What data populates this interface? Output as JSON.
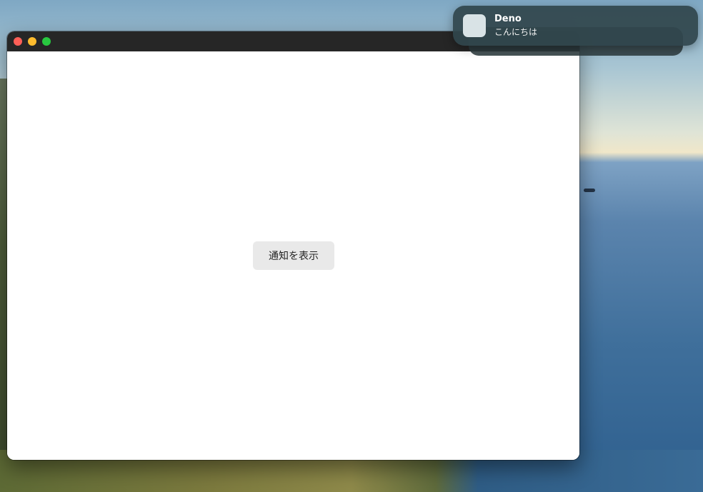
{
  "window": {
    "controls": [
      "close",
      "minimize",
      "zoom"
    ]
  },
  "main": {
    "button_label": "通知を表示"
  },
  "notification": {
    "title": "Deno",
    "body": "こんにちは",
    "icon": "app-icon-placeholder"
  },
  "colors": {
    "titlebar": "#262626",
    "close": "#fe5f57",
    "minimize": "#febc2e",
    "zoom": "#28c840",
    "button_bg": "#e9e9e9"
  }
}
